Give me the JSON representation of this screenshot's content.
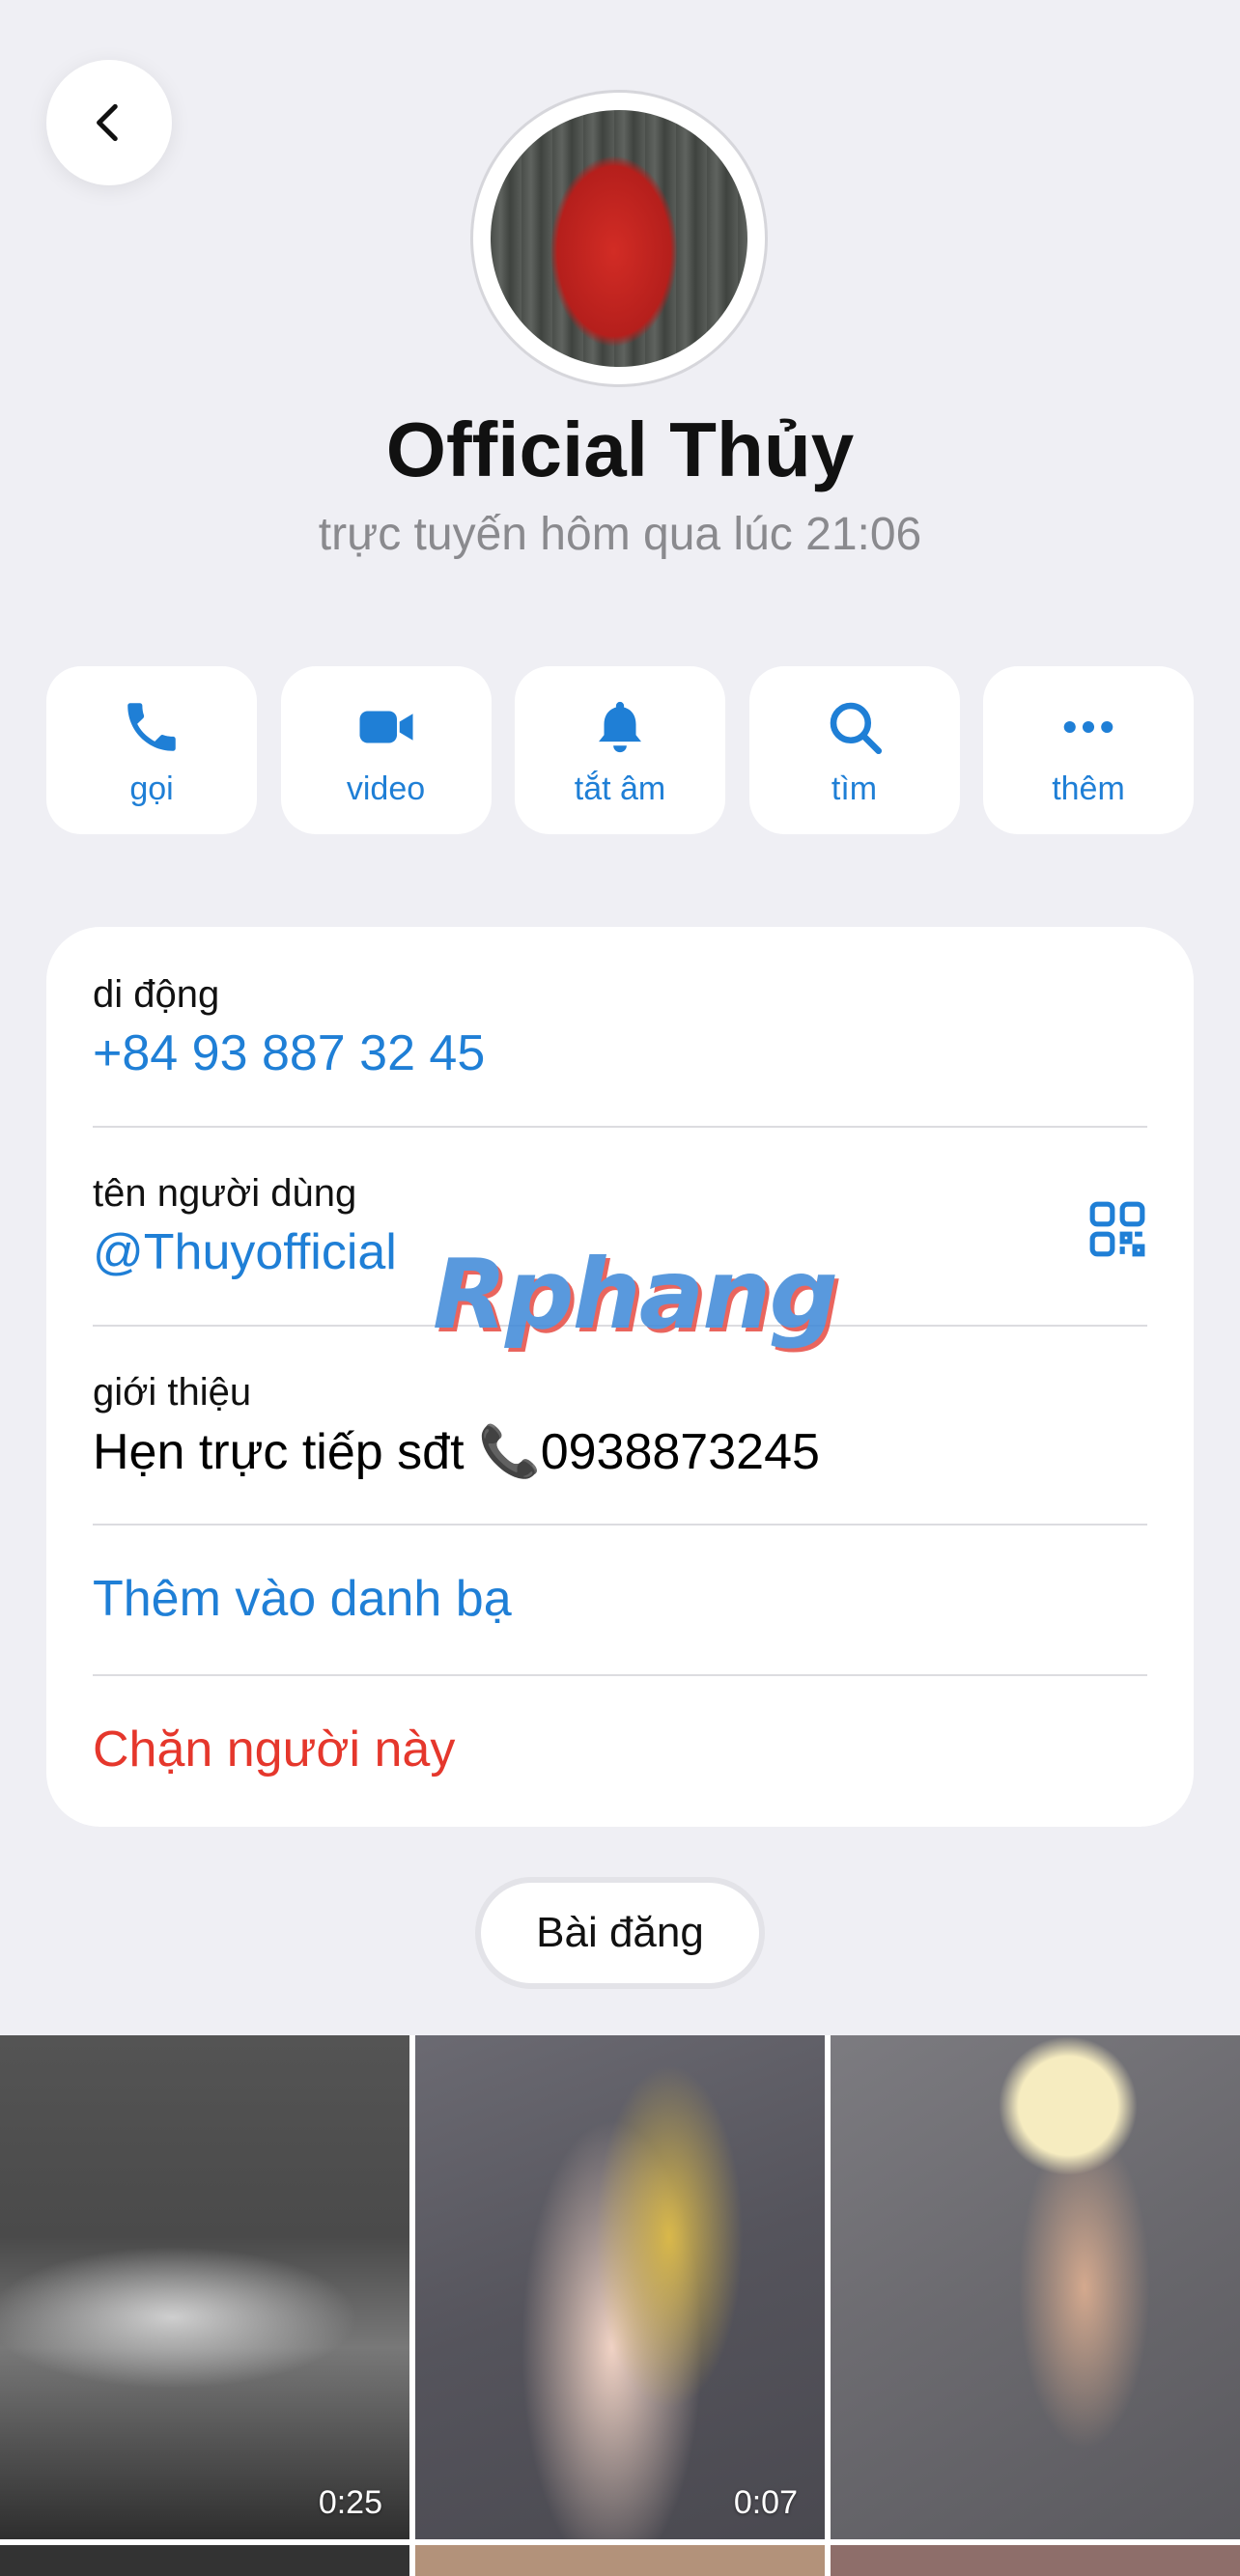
{
  "header": {
    "back_icon": "chevron-left-icon"
  },
  "profile": {
    "name": "Official Thủy",
    "status": "trực tuyến hôm qua lúc 21:06"
  },
  "actions": [
    {
      "label": "gọi",
      "icon": "phone-icon"
    },
    {
      "label": "video",
      "icon": "video-camera-icon"
    },
    {
      "label": "tắt âm",
      "icon": "bell-icon"
    },
    {
      "label": "tìm",
      "icon": "search-icon"
    },
    {
      "label": "thêm",
      "icon": "more-icon"
    }
  ],
  "info": {
    "mobile_caption": "di động",
    "mobile_value": "+84 93 887 32 45",
    "username_caption": "tên người dùng",
    "username_value": "@Thuyofficial",
    "bio_caption": "giới thiệu",
    "bio_value": "Hẹn trực tiếp sđt 📞0938873245",
    "add_contact": "Thêm vào danh bạ",
    "block": "Chặn người này"
  },
  "watermark": "Rphang",
  "tabs": {
    "posts_label": "Bài đăng"
  },
  "media": [
    {
      "duration": "0:25"
    },
    {
      "duration": "0:07"
    },
    {
      "duration": ""
    }
  ],
  "colors": {
    "accent": "#1f7fd6",
    "danger": "#e5372c",
    "background": "#efeff4"
  }
}
